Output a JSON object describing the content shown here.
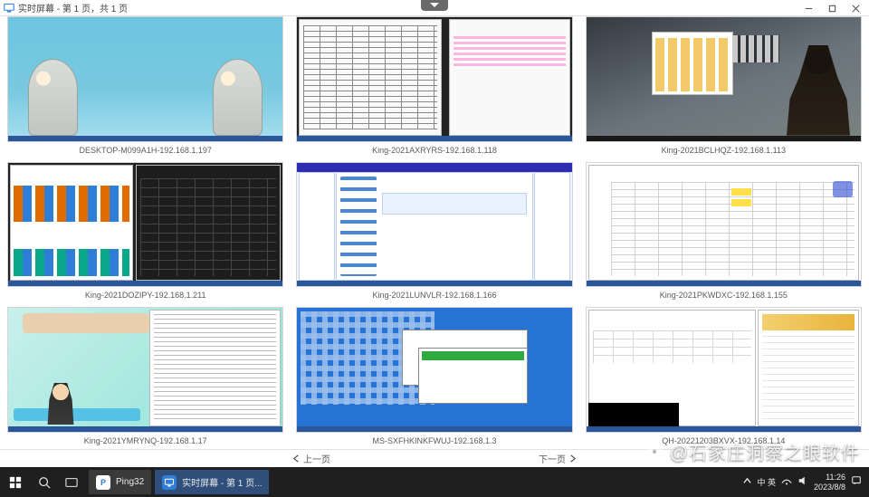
{
  "window": {
    "title": "实时屏幕 - 第 1 页，共 1 页",
    "controls": {
      "minimize": "—",
      "maximize": "□",
      "close": "✕"
    }
  },
  "thumbnails": [
    {
      "caption": "DESKTOP-M099A1H-192.168.1.197"
    },
    {
      "caption": "King-2021AXRYRS-192.168.1.118"
    },
    {
      "caption": "King-2021BCLHQZ-192.168.1.113"
    },
    {
      "caption": "King-2021DOZIPY-192.168.1.211"
    },
    {
      "caption": "King-2021LUNVLR-192.168.1.166"
    },
    {
      "caption": "King-2021PKWDXC-192.168.1.155"
    },
    {
      "caption": "King-2021YMRYNQ-192.168.1.17"
    },
    {
      "caption": "MS-SXFHKINKFWUJ-192.168.1.3"
    },
    {
      "caption": "QH-20221203BXVX-192.168.1.14"
    }
  ],
  "pager": {
    "prev": "上一页",
    "next": "下一页"
  },
  "taskbar": {
    "app1_label": "Ping32",
    "app2_label": "实时屏幕 - 第 1 页...",
    "ime": "中 英",
    "time": "11:26",
    "date": "2023/8/8"
  },
  "watermark": {
    "handle": "@石家庄洞察之眼软件"
  }
}
